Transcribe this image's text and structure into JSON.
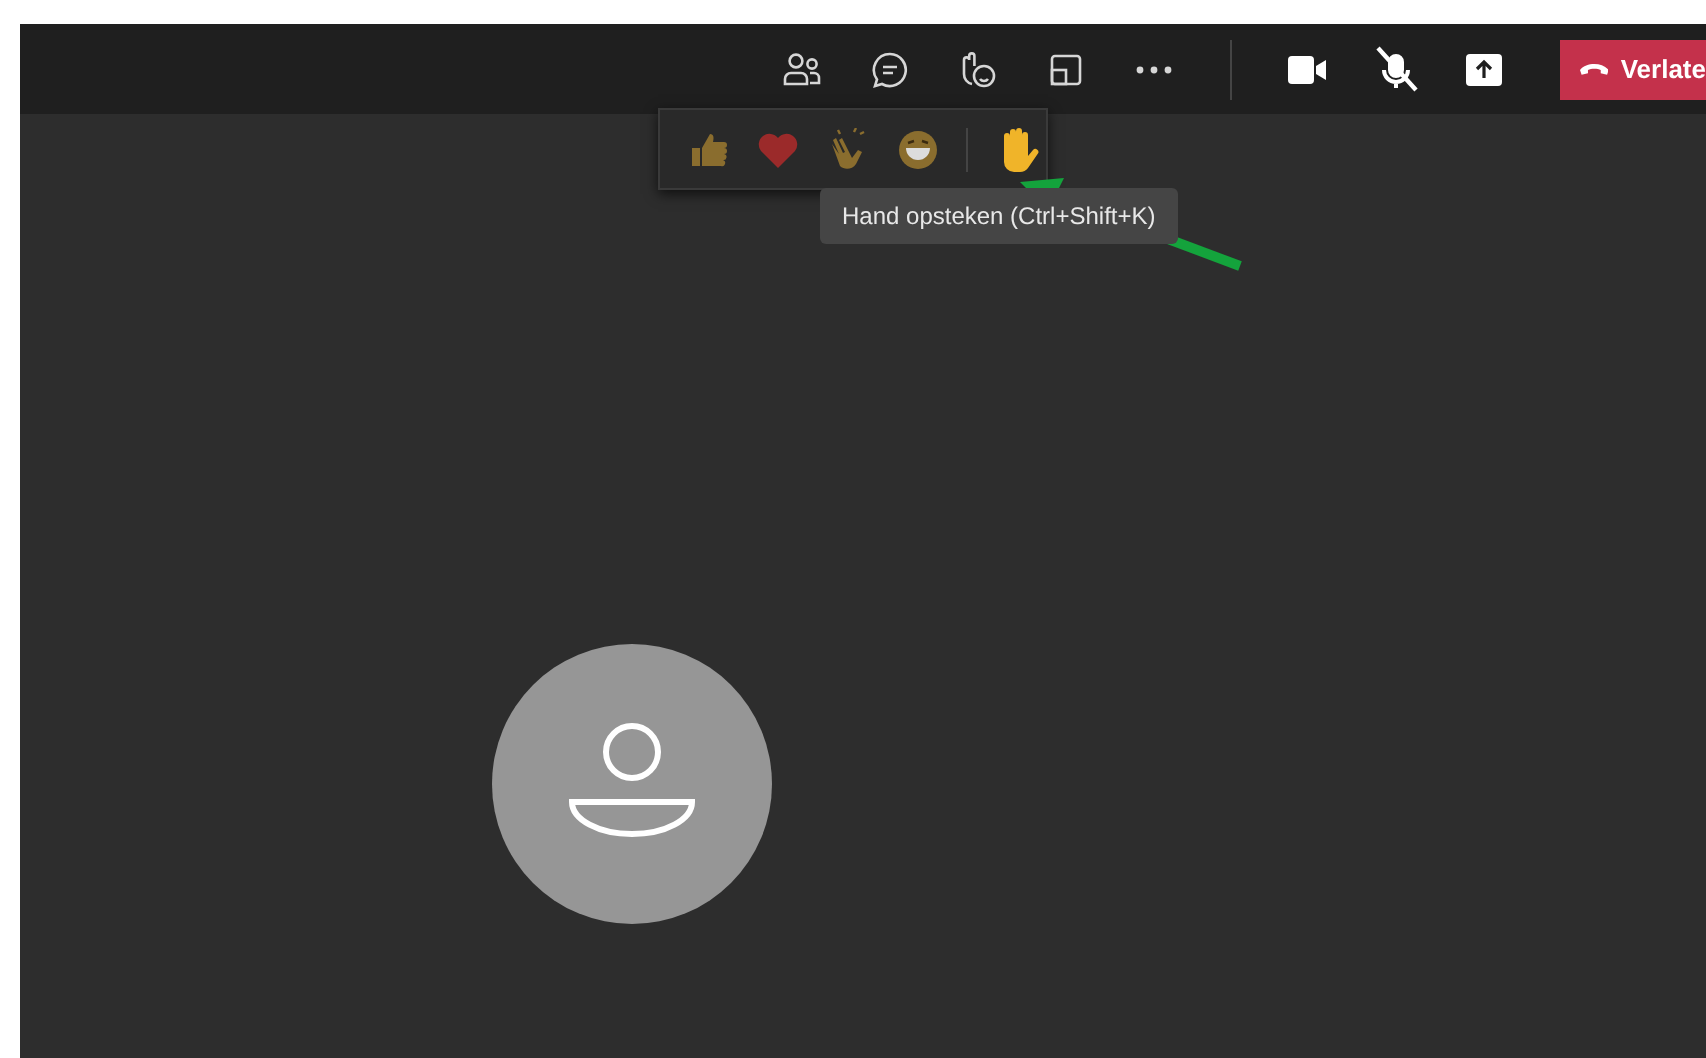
{
  "toolbar": {
    "buttons": [
      {
        "kind": "people"
      },
      {
        "kind": "chat"
      },
      {
        "kind": "reactions"
      },
      {
        "kind": "rooms"
      },
      {
        "kind": "more"
      },
      {
        "kind": "divider"
      },
      {
        "kind": "camera"
      },
      {
        "kind": "mic-off"
      },
      {
        "kind": "share"
      }
    ],
    "leave_button": {
      "label": "Verlate"
    }
  },
  "reactions": [
    {
      "kind": "thumbs"
    },
    {
      "kind": "heart"
    },
    {
      "kind": "clap"
    },
    {
      "kind": "laugh"
    },
    {
      "kind": "hand"
    }
  ],
  "tooltip": {
    "text": "Hand opsteken (Ctrl+Shift+K)"
  },
  "annotation": {
    "kind": "arrow",
    "color": "#14a33c"
  }
}
